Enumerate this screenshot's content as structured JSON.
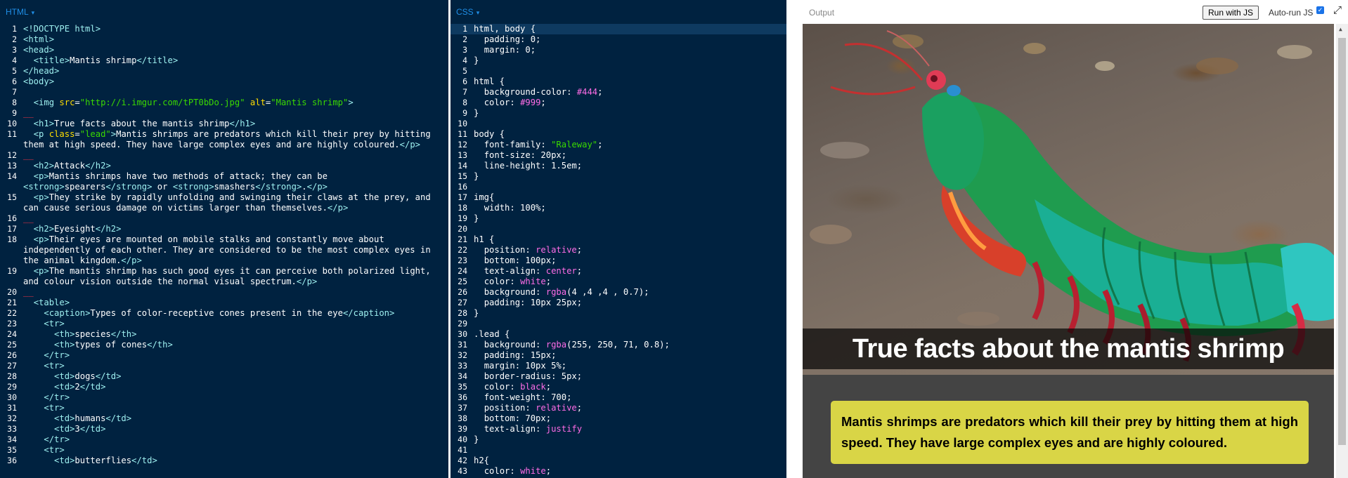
{
  "editors": {
    "html_label": "HTML",
    "css_label": "CSS",
    "caret": "▾"
  },
  "html_lines": [
    {
      "n": "1",
      "t": "<!DOCTYPE html>"
    },
    {
      "n": "2",
      "t": "<html>"
    },
    {
      "n": "3",
      "t": "<head>"
    },
    {
      "n": "4",
      "t": "  <title>Mantis shrimp</title>"
    },
    {
      "n": "5",
      "t": "</head>"
    },
    {
      "n": "6",
      "t": "<body>"
    },
    {
      "n": "7",
      "t": ""
    },
    {
      "n": "8",
      "t": "  <img src=\"http://i.imgur.com/tPT0bDo.jpg\" alt=\"Mantis shrimp\">"
    },
    {
      "n": "9",
      "t": "",
      "mark": true
    },
    {
      "n": "10",
      "t": "  <h1>True facts about the mantis shrimp</h1>"
    },
    {
      "n": "11",
      "t": "  <p class=\"lead\">Mantis shrimps are predators which kill their prey by hitting them at high speed. They have large complex eyes and are highly coloured.</p>"
    },
    {
      "n": "12",
      "t": "",
      "mark": true
    },
    {
      "n": "13",
      "t": "  <h2>Attack</h2>"
    },
    {
      "n": "14",
      "t": "  <p>Mantis shrimps have two methods of attack; they can be <strong>spearers</strong> or <strong>smashers</strong>.</p>"
    },
    {
      "n": "15",
      "t": "  <p>They strike by rapidly unfolding and swinging their claws at the prey, and can cause serious damage on victims larger than themselves.</p>"
    },
    {
      "n": "16",
      "t": "",
      "mark": true
    },
    {
      "n": "17",
      "t": "  <h2>Eyesight</h2>"
    },
    {
      "n": "18",
      "t": "  <p>Their eyes are mounted on mobile stalks and constantly move about independently of each other. They are considered to be the most complex eyes in the animal kingdom.</p>"
    },
    {
      "n": "19",
      "t": "  <p>The mantis shrimp has such good eyes it can perceive both polarized light, and colour vision outside the normal visual spectrum.</p>"
    },
    {
      "n": "20",
      "t": "",
      "mark": true
    },
    {
      "n": "21",
      "t": "  <table>"
    },
    {
      "n": "22",
      "t": "    <caption>Types of color-receptive cones present in the eye</caption>"
    },
    {
      "n": "23",
      "t": "    <tr>"
    },
    {
      "n": "24",
      "t": "      <th>species</th>"
    },
    {
      "n": "25",
      "t": "      <th>types of cones</th>"
    },
    {
      "n": "26",
      "t": "    </tr>"
    },
    {
      "n": "27",
      "t": "    <tr>"
    },
    {
      "n": "28",
      "t": "      <td>dogs</td>"
    },
    {
      "n": "29",
      "t": "      <td>2</td>"
    },
    {
      "n": "30",
      "t": "    </tr>"
    },
    {
      "n": "31",
      "t": "    <tr>"
    },
    {
      "n": "32",
      "t": "      <td>humans</td>"
    },
    {
      "n": "33",
      "t": "      <td>3</td>"
    },
    {
      "n": "34",
      "t": "    </tr>"
    },
    {
      "n": "35",
      "t": "    <tr>"
    },
    {
      "n": "36",
      "t": "      <td>butterflies</td>"
    }
  ],
  "css_lines": [
    {
      "n": "1",
      "t": "html, body {",
      "active": true
    },
    {
      "n": "2",
      "t": "  padding: 0;"
    },
    {
      "n": "3",
      "t": "  margin: 0;"
    },
    {
      "n": "4",
      "t": "}"
    },
    {
      "n": "5",
      "t": ""
    },
    {
      "n": "6",
      "t": "html {"
    },
    {
      "n": "7",
      "t": "  background-color: #444;"
    },
    {
      "n": "8",
      "t": "  color: #999;"
    },
    {
      "n": "9",
      "t": "}"
    },
    {
      "n": "10",
      "t": ""
    },
    {
      "n": "11",
      "t": "body {"
    },
    {
      "n": "12",
      "t": "  font-family: \"Raleway\";"
    },
    {
      "n": "13",
      "t": "  font-size: 20px;"
    },
    {
      "n": "14",
      "t": "  line-height: 1.5em;"
    },
    {
      "n": "15",
      "t": "}"
    },
    {
      "n": "16",
      "t": ""
    },
    {
      "n": "17",
      "t": "img{"
    },
    {
      "n": "18",
      "t": "  width: 100%;"
    },
    {
      "n": "19",
      "t": "}"
    },
    {
      "n": "20",
      "t": ""
    },
    {
      "n": "21",
      "t": "h1 {"
    },
    {
      "n": "22",
      "t": "  position: relative;"
    },
    {
      "n": "23",
      "t": "  bottom: 100px;"
    },
    {
      "n": "24",
      "t": "  text-align: center;"
    },
    {
      "n": "25",
      "t": "  color: white;"
    },
    {
      "n": "26",
      "t": "  background: rgba(4 ,4 ,4 , 0.7);"
    },
    {
      "n": "27",
      "t": "  padding: 10px 25px;"
    },
    {
      "n": "28",
      "t": "}"
    },
    {
      "n": "29",
      "t": ""
    },
    {
      "n": "30",
      "t": ".lead {"
    },
    {
      "n": "31",
      "t": "  background: rgba(255, 250, 71, 0.8);"
    },
    {
      "n": "32",
      "t": "  padding: 15px;"
    },
    {
      "n": "33",
      "t": "  margin: 10px 5%;"
    },
    {
      "n": "34",
      "t": "  border-radius: 5px;"
    },
    {
      "n": "35",
      "t": "  color: black;"
    },
    {
      "n": "36",
      "t": "  font-weight: 700;"
    },
    {
      "n": "37",
      "t": "  position: relative;"
    },
    {
      "n": "38",
      "t": "  bottom: 70px;"
    },
    {
      "n": "39",
      "t": "  text-align: justify"
    },
    {
      "n": "40",
      "t": "}"
    },
    {
      "n": "41",
      "t": ""
    },
    {
      "n": "42",
      "t": "h2{"
    },
    {
      "n": "43",
      "t": "  color: white;"
    }
  ],
  "output": {
    "title": "Output",
    "run_button": "Run with JS",
    "autorun_label": "Auto-run JS",
    "autorun_checked": true,
    "h1": "True facts about the mantis shrimp",
    "lead": "Mantis shrimps are predators which kill their prey by hitting them at high speed. They have large complex eyes and are highly coloured.",
    "image_alt": "Mantis shrimp"
  },
  "colors": {
    "editor_bg": "#002240",
    "tag": "#9ef0f0",
    "attr": "#ffdd00",
    "string": "#3ad900",
    "keyword": "#ff6ce6",
    "preview_bg": "#444444",
    "lead_bg": "rgba(255,250,71,0.8)"
  }
}
